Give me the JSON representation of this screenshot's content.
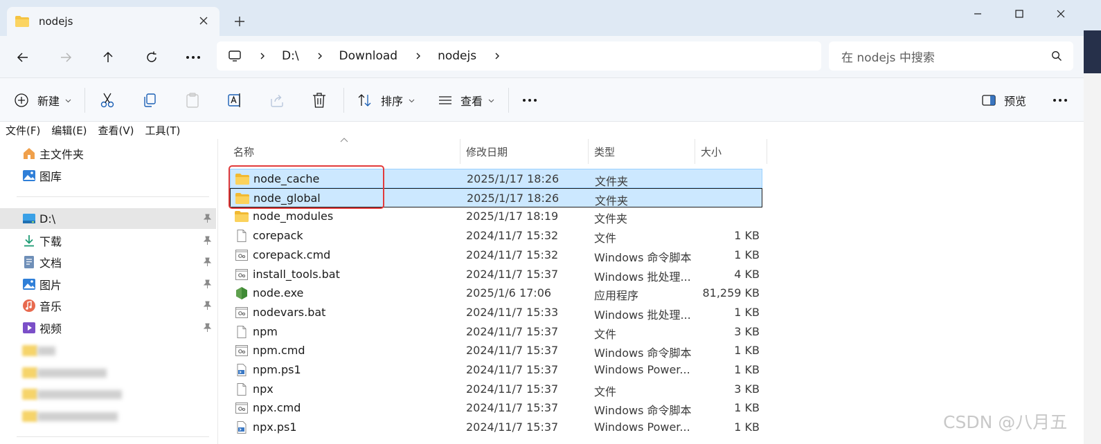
{
  "window": {
    "tab_title": "nodejs",
    "new_tab_symbol": "+"
  },
  "address": {
    "crumbs": [
      "D:\\",
      "Download",
      "nodejs"
    ],
    "search_placeholder": "在 nodejs 中搜索"
  },
  "toolbar": {
    "new_label": "新建",
    "sort_label": "排序",
    "view_label": "查看",
    "more_label": "•••",
    "preview_label": "预览",
    "icons": [
      "cut-icon",
      "copy-icon",
      "paste-icon",
      "rename-icon",
      "share-icon",
      "delete-icon"
    ]
  },
  "menu": [
    "文件(F)",
    "编辑(E)",
    "查看(V)",
    "工具(T)"
  ],
  "sidebar": {
    "top": [
      {
        "label": "主文件夹",
        "icon": "home-icon"
      },
      {
        "label": "图库",
        "icon": "gallery-icon"
      }
    ],
    "pinned": [
      {
        "label": "D:\\",
        "icon": "drive-icon",
        "selected": true
      },
      {
        "label": "下载",
        "icon": "download-icon"
      },
      {
        "label": "文档",
        "icon": "document-icon"
      },
      {
        "label": "图片",
        "icon": "pictures-icon"
      },
      {
        "label": "音乐",
        "icon": "music-icon"
      },
      {
        "label": "视频",
        "icon": "video-icon"
      }
    ]
  },
  "columns": {
    "name": "名称",
    "date": "修改日期",
    "type": "类型",
    "size": "大小"
  },
  "files": [
    {
      "name": "node_cache",
      "date": "2025/1/17 18:26",
      "type": "文件夹",
      "size": "",
      "icon": "folder",
      "selected": true
    },
    {
      "name": "node_global",
      "date": "2025/1/17 18:26",
      "type": "文件夹",
      "size": "",
      "icon": "folder",
      "selected": true,
      "focus": true
    },
    {
      "name": "node_modules",
      "date": "2025/1/17 18:19",
      "type": "文件夹",
      "size": "",
      "icon": "folder"
    },
    {
      "name": "corepack",
      "date": "2024/11/7 15:32",
      "type": "文件",
      "size": "1 KB",
      "icon": "file"
    },
    {
      "name": "corepack.cmd",
      "date": "2024/11/7 15:32",
      "type": "Windows 命令脚本",
      "size": "1 KB",
      "icon": "script"
    },
    {
      "name": "install_tools.bat",
      "date": "2024/11/7 15:37",
      "type": "Windows 批处理...",
      "size": "4 KB",
      "icon": "script"
    },
    {
      "name": "node.exe",
      "date": "2025/1/6 17:06",
      "type": "应用程序",
      "size": "81,259 KB",
      "icon": "node"
    },
    {
      "name": "nodevars.bat",
      "date": "2024/11/7 15:33",
      "type": "Windows 批处理...",
      "size": "1 KB",
      "icon": "script"
    },
    {
      "name": "npm",
      "date": "2024/11/7 15:37",
      "type": "文件",
      "size": "3 KB",
      "icon": "file"
    },
    {
      "name": "npm.cmd",
      "date": "2024/11/7 15:37",
      "type": "Windows 命令脚本",
      "size": "1 KB",
      "icon": "script"
    },
    {
      "name": "npm.ps1",
      "date": "2024/11/7 15:37",
      "type": "Windows Power...",
      "size": "1 KB",
      "icon": "ps1"
    },
    {
      "name": "npx",
      "date": "2024/11/7 15:37",
      "type": "文件",
      "size": "3 KB",
      "icon": "file"
    },
    {
      "name": "npx.cmd",
      "date": "2024/11/7 15:37",
      "type": "Windows 命令脚本",
      "size": "1 KB",
      "icon": "script"
    },
    {
      "name": "npx.ps1",
      "date": "2024/11/7 15:37",
      "type": "Windows Power...",
      "size": "1 KB",
      "icon": "ps1"
    }
  ],
  "watermark": "CSDN @八月五"
}
